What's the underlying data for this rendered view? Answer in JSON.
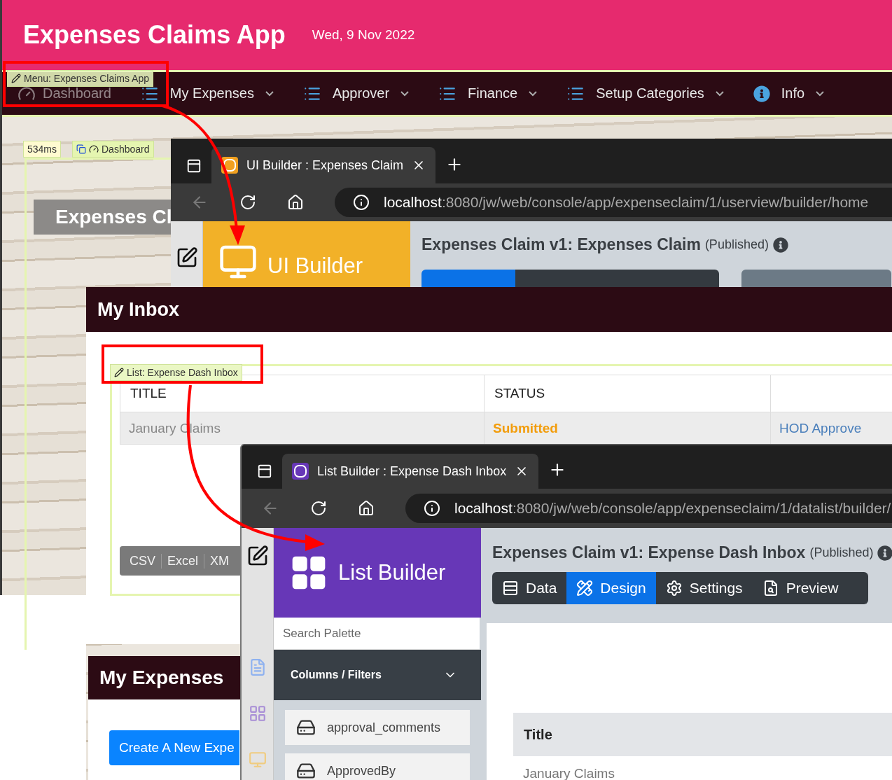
{
  "app": {
    "title": "Expenses Claims App",
    "date": "Wed, 9 Nov 2022",
    "menu": [
      {
        "label": "Dashboard",
        "kind": "dashboard",
        "dropdown": false
      },
      {
        "label": "My Expenses",
        "kind": "list",
        "dropdown": true
      },
      {
        "label": "Approver",
        "kind": "list",
        "dropdown": true
      },
      {
        "label": "Finance",
        "kind": "list",
        "dropdown": true
      },
      {
        "label": "Setup Categories",
        "kind": "list",
        "dropdown": true
      },
      {
        "label": "Info",
        "kind": "info",
        "dropdown": true
      }
    ],
    "menu_badge": "Menu: Expenses Claims App",
    "timing": "534ms",
    "page_badge": "Dashboard",
    "page_title": "Expenses Cl"
  },
  "ui_builder_window": {
    "tab_title": "UI Builder : Expenses Claim",
    "url_host": "localhost",
    "url_path": ":8080/jw/web/console/app/expenseclaim/1/userview/builder/home",
    "builder_name": "UI Builder",
    "heading": "Expenses Claim v1: Expenses Claim",
    "status": "(Published)"
  },
  "inbox": {
    "title": "My Inbox",
    "list_badge": "List: Expense Dash Inbox",
    "columns": [
      "TITLE",
      "STATUS"
    ],
    "rows": [
      {
        "cells": [
          {
            "text": "January Claims",
            "kind": "text"
          },
          {
            "text": "Submitted",
            "kind": "status"
          },
          {
            "text": "HOD Approve",
            "kind": "link"
          }
        ]
      }
    ],
    "exports": [
      "CSV",
      "Excel",
      "XM"
    ]
  },
  "expenses": {
    "title": "My Expenses",
    "button": "Create A New Expe"
  },
  "list_builder_window": {
    "tab_title": "List Builder : Expense Dash Inbox",
    "url_host": "localhost",
    "url_path": ":8080/jw/web/console/app/expenseclaim/1/datalist/builder/",
    "builder_name": "List Builder",
    "heading": "Expenses Claim v1: Expense Dash Inbox",
    "status": "(Published)",
    "tabs": [
      {
        "label": "Data",
        "kind": "data",
        "selected": false
      },
      {
        "label": "Design",
        "kind": "design",
        "selected": true
      },
      {
        "label": "Settings",
        "kind": "settings",
        "selected": false
      },
      {
        "label": "Preview",
        "kind": "preview",
        "selected": false
      }
    ],
    "search": {
      "placeholder": "Search Palette"
    },
    "section": "Columns / Filters",
    "palette_items": [
      "approval_comments",
      "ApprovedBy"
    ],
    "canvas_column": "Title",
    "canvas_row": "January Claims"
  }
}
